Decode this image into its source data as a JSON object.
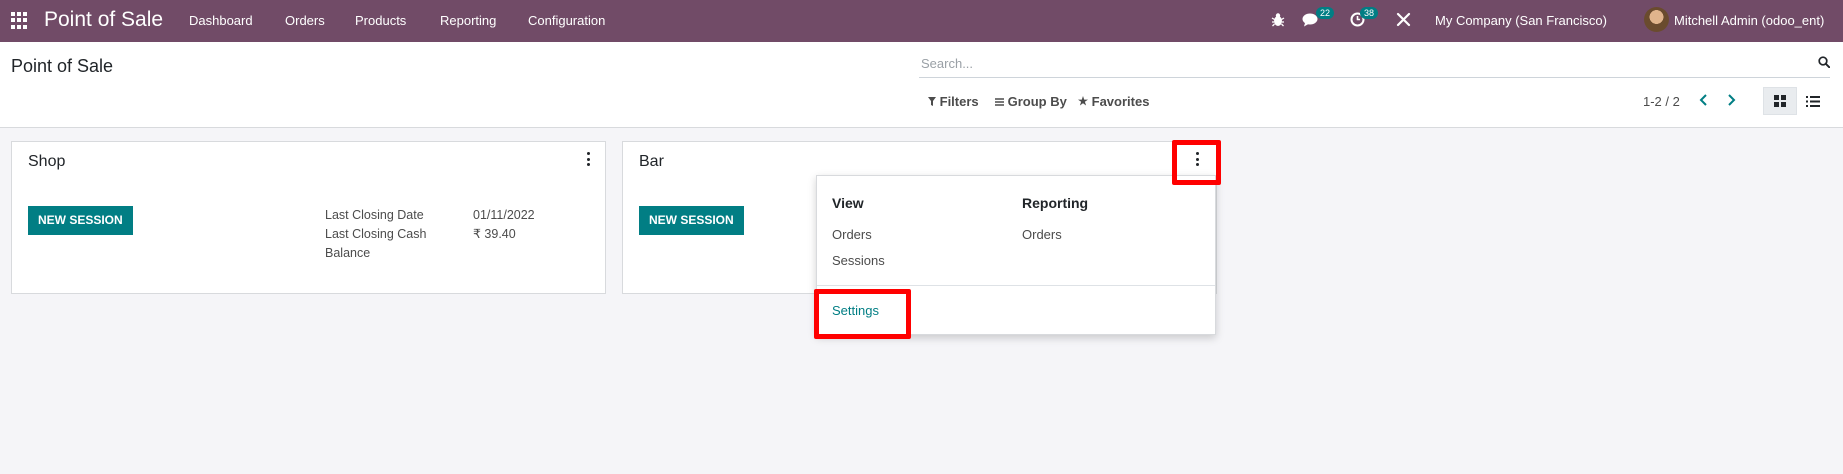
{
  "navbar": {
    "app_title": "Point of Sale",
    "menu": [
      "Dashboard",
      "Orders",
      "Products",
      "Reporting",
      "Configuration"
    ],
    "messages_badge": "22",
    "activities_badge": "38",
    "company": "My Company (San Francisco)",
    "user": "Mitchell Admin (odoo_ent)",
    "icons": [
      "apps-grid-icon",
      "bug-icon",
      "chat-icon",
      "clock-icon",
      "tools-icon"
    ]
  },
  "control": {
    "title": "Point of Sale",
    "search_placeholder": "Search...",
    "filters": "Filters",
    "group_by": "Group By",
    "favorites": "Favorites",
    "pager": "1-2 / 2"
  },
  "cards": [
    {
      "title": "Shop",
      "button": "NEW SESSION",
      "label_date": "Last Closing Date",
      "value_date": "01/11/2022",
      "label_cash_1": "Last Closing Cash",
      "label_cash_2": "Balance",
      "value_cash": "₹ 39.40"
    },
    {
      "title": "Bar",
      "button": "NEW SESSION"
    }
  ],
  "dropdown": {
    "view_heading": "View",
    "view_items": [
      "Orders",
      "Sessions"
    ],
    "reporting_heading": "Reporting",
    "reporting_items": [
      "Orders"
    ],
    "settings": "Settings"
  },
  "colors": {
    "navbar": "#714b67",
    "primary": "#017e84",
    "highlight": "#ff0000"
  }
}
